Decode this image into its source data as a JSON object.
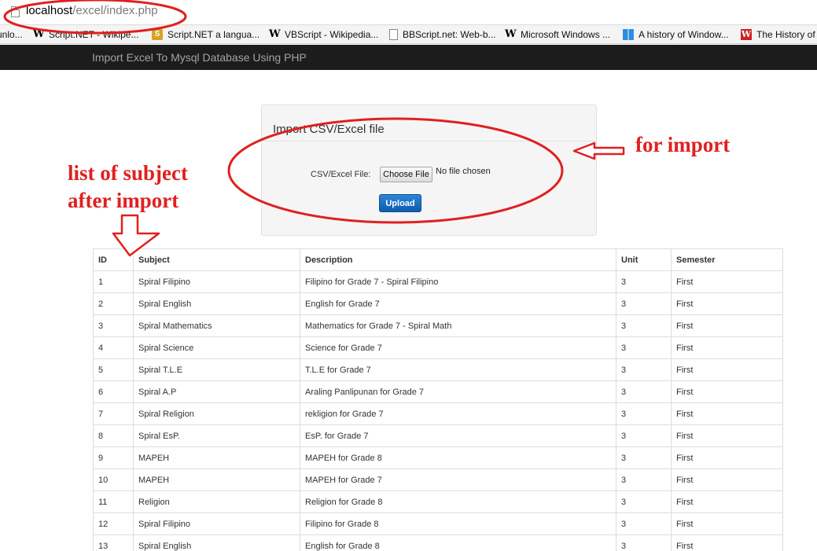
{
  "browser": {
    "url_host": "localhost",
    "url_path": "/excel/index.php",
    "bookmarks": [
      {
        "label": "unlo...",
        "icon": "none"
      },
      {
        "label": "Script.NET - Wikipe...",
        "icon": "wikipedia-icon"
      },
      {
        "label": "Script.NET a langua...",
        "icon": "script-net-icon"
      },
      {
        "label": "VBScript - Wikipedia...",
        "icon": "wikipedia-icon"
      },
      {
        "label": "BBScript.net: Web-b...",
        "icon": "page-icon"
      },
      {
        "label": "Microsoft Windows ...",
        "icon": "wikipedia-icon"
      },
      {
        "label": "A history of Window...",
        "icon": "windows-icon"
      },
      {
        "label": "The History of",
        "icon": "history-icon"
      }
    ]
  },
  "navbar": {
    "brand": "Import Excel To Mysql Database Using PHP"
  },
  "import_panel": {
    "title": "Import CSV/Excel file",
    "file_label": "CSV/Excel File:",
    "choose_button": "Choose File",
    "file_status": "No file chosen",
    "upload_button": "Upload"
  },
  "table": {
    "headers": [
      "ID",
      "Subject",
      "Description",
      "Unit",
      "Semester"
    ],
    "rows": [
      [
        "1",
        "Spiral Filipino",
        "Filipino for Grade 7 - Spiral Filipino",
        "3",
        "First"
      ],
      [
        "2",
        "Spiral English",
        "English for Grade 7",
        "3",
        "First"
      ],
      [
        "3",
        "Spiral Mathematics",
        "Mathematics for Grade 7 - Spiral Math",
        "3",
        "First"
      ],
      [
        "4",
        "Spiral Science",
        "Science for Grade 7",
        "3",
        "First"
      ],
      [
        "5",
        "Spiral T.L.E",
        "T.L.E for Grade 7",
        "3",
        "First"
      ],
      [
        "6",
        "Spiral A.P",
        "Araling Panlipunan for Grade 7",
        "3",
        "First"
      ],
      [
        "7",
        "Spiral Religion",
        "rekligion for Grade 7",
        "3",
        "First"
      ],
      [
        "8",
        "Spiral EsP.",
        "EsP. for Grade 7",
        "3",
        "First"
      ],
      [
        "9",
        "MAPEH",
        "MAPEH for Grade 8",
        "3",
        "First"
      ],
      [
        "10",
        "MAPEH",
        "MAPEH for Grade 7",
        "3",
        "First"
      ],
      [
        "11",
        "Religion",
        "Religion for Grade 8",
        "3",
        "First"
      ],
      [
        "12",
        "Spiral Filipino",
        "Filipino for Grade 8",
        "3",
        "First"
      ],
      [
        "13",
        "Spiral English",
        "English for Grade 8",
        "3",
        "First"
      ]
    ]
  },
  "annotations": {
    "import_note": "for import",
    "list_note_line1": "list of subject",
    "list_note_line2": "after import",
    "color": "#e02020"
  }
}
